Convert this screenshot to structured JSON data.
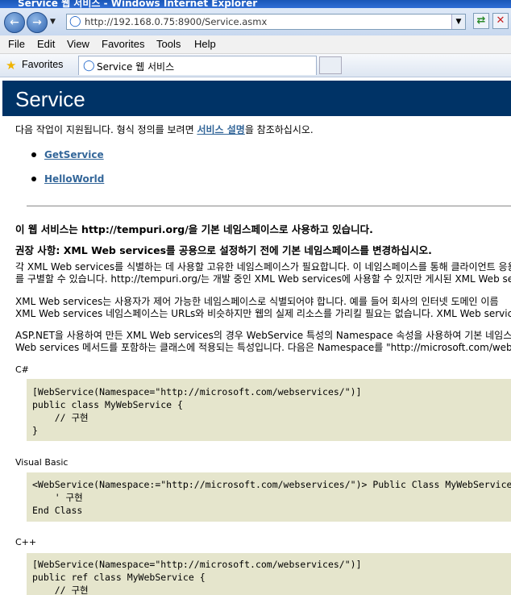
{
  "window": {
    "title": "Service 웹 서비스 - Windows Internet Explorer"
  },
  "address_bar": {
    "url": "http://192.168.0.75:8900/Service.asmx"
  },
  "menu": [
    "File",
    "Edit",
    "View",
    "Favorites",
    "Tools",
    "Help"
  ],
  "favorites": {
    "label": "Favorites",
    "tab_title": "Service 웹 서비스"
  },
  "page": {
    "heading": "Service",
    "intro_before": "다음 작업이 지원됩니다. 형식 정의를 보려면 ",
    "intro_link": "서비스 설명",
    "intro_after": "을 참조하십시오.",
    "operations": [
      "GetService",
      "HelloWorld"
    ],
    "notice": "이 웹 서비스는 http://tempuri.org/을 기본 네임스페이스로 사용하고 있습니다.",
    "recommendation": "권장 사항: XML Web services를 공용으로 설정하기 전에 기본 네임스페이스를 변경하십시오.",
    "para1_line1": "각 XML Web services를 식별하는 데 사용할 고유한 네임스페이스가 필요합니다. 이 네임스페이스를 통해 클라이언트 응용",
    "para1_line2": "를 구별할 수 있습니다. http://tempuri.org/는 개발 중인 XML Web services에 사용할 수 있지만 게시된 XML Web services",
    "para2_line1": "XML Web services는 사용자가 제어 가능한 네임스페이스로 식별되어야 합니다. 예를 들어 회사의 인터넷 도메인 이름",
    "para2_line2": "XML Web services 네임스페이스는 URLs와 비슷하지만 웹의 실제 리소스를 가리킬 필요는 없습니다. XML Web services",
    "para3_line1": "ASP.NET을 사용하여 만든 XML Web services의 경우 WebService 특성의 Namespace 속성을 사용하여 기본 네임스페이스",
    "para3_line2": "Web services 메서드를 포함하는 클래스에 적용되는 특성입니다. 다음은 Namespace를 \"http://microsoft.com/webservices/\"",
    "csharp_label": "C#",
    "csharp_code": "[WebService(Namespace=\"http://microsoft.com/webservices/\")]\npublic class MyWebService {\n    // 구현\n}",
    "vb_label": "Visual Basic",
    "vb_code": "<WebService(Namespace:=\"http://microsoft.com/webservices/\")> Public Class MyWebService\n    ' 구현\nEnd Class",
    "cpp_label": "C++",
    "cpp_code": "[WebService(Namespace=\"http://microsoft.com/webservices/\")]\npublic ref class MyWebService {\n    // 구현"
  }
}
